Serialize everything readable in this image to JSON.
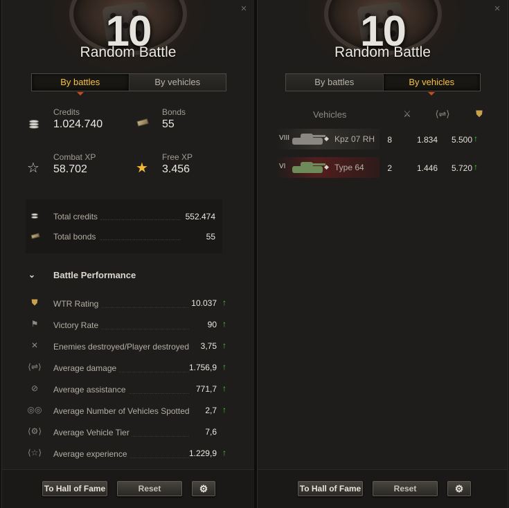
{
  "left_panel": {
    "battle_count": "10",
    "mode_title": "Random Battle",
    "tabs": [
      {
        "label": "By battles",
        "active": true
      },
      {
        "label": "By vehicles",
        "active": false
      }
    ],
    "summary": {
      "credits": {
        "label": "Credits",
        "value": "1.024.740",
        "icon": "credits-icon"
      },
      "bonds": {
        "label": "Bonds",
        "value": "55",
        "icon": "bonds-icon"
      },
      "combat_xp": {
        "label": "Combat XP",
        "value": "58.702",
        "icon": "star-outline-icon"
      },
      "free_xp": {
        "label": "Free XP",
        "value": "3.456",
        "icon": "star-filled-icon"
      }
    },
    "totals": {
      "total_credits": {
        "label": "Total credits",
        "value": "552.474"
      },
      "total_bonds": {
        "label": "Total bonds",
        "value": "55"
      }
    },
    "section_title": "Battle Performance",
    "performance": [
      {
        "label": "WTR Rating",
        "value": "10.037",
        "trend": "up",
        "icon": "wtr-icon"
      },
      {
        "label": "Victory Rate",
        "value": "90",
        "trend": "up",
        "icon": "flag-icon"
      },
      {
        "label": "Enemies destroyed/Player destroyed",
        "value": "3,75",
        "trend": "up",
        "icon": "destroyed-icon"
      },
      {
        "label": "Average damage",
        "value": "1.756,9",
        "trend": "up",
        "icon": "damage-icon"
      },
      {
        "label": "Average assistance",
        "value": "771,7",
        "trend": "up",
        "icon": "assist-icon"
      },
      {
        "label": "Average Number of Vehicles Spotted",
        "value": "2,7",
        "trend": "up",
        "icon": "spotted-icon"
      },
      {
        "label": "Average Vehicle Tier",
        "value": "7,6",
        "trend": "none",
        "icon": "tier-icon"
      },
      {
        "label": "Average experience",
        "value": "1.229,9",
        "trend": "up",
        "icon": "xp-icon"
      }
    ],
    "buttons": {
      "hall_of_fame": "To Hall of Fame",
      "reset": "Reset"
    }
  },
  "right_panel": {
    "battle_count": "10",
    "mode_title": "Random Battle",
    "tabs": [
      {
        "label": "By battles",
        "active": false
      },
      {
        "label": "By vehicles",
        "active": true
      }
    ],
    "table": {
      "vehicles_header": "Vehicles",
      "column_icons": [
        "battles-icon",
        "damage-icon",
        "wtr-icon"
      ],
      "rows": [
        {
          "tier": "VIII",
          "name": "Kpz 07 RH",
          "battles": "8",
          "damage": "1.834",
          "wtr": "5.500",
          "trend": "up",
          "highlight": "gray"
        },
        {
          "tier": "VI",
          "name": "Type 64",
          "battles": "2",
          "damage": "1.446",
          "wtr": "5.720",
          "trend": "up",
          "highlight": "red"
        }
      ]
    },
    "buttons": {
      "hall_of_fame": "To Hall of Fame",
      "reset": "Reset"
    }
  },
  "colors": {
    "accent": "#f7c241",
    "trend_up": "#3fd12e",
    "panel_bg": "#1e1d1b"
  }
}
